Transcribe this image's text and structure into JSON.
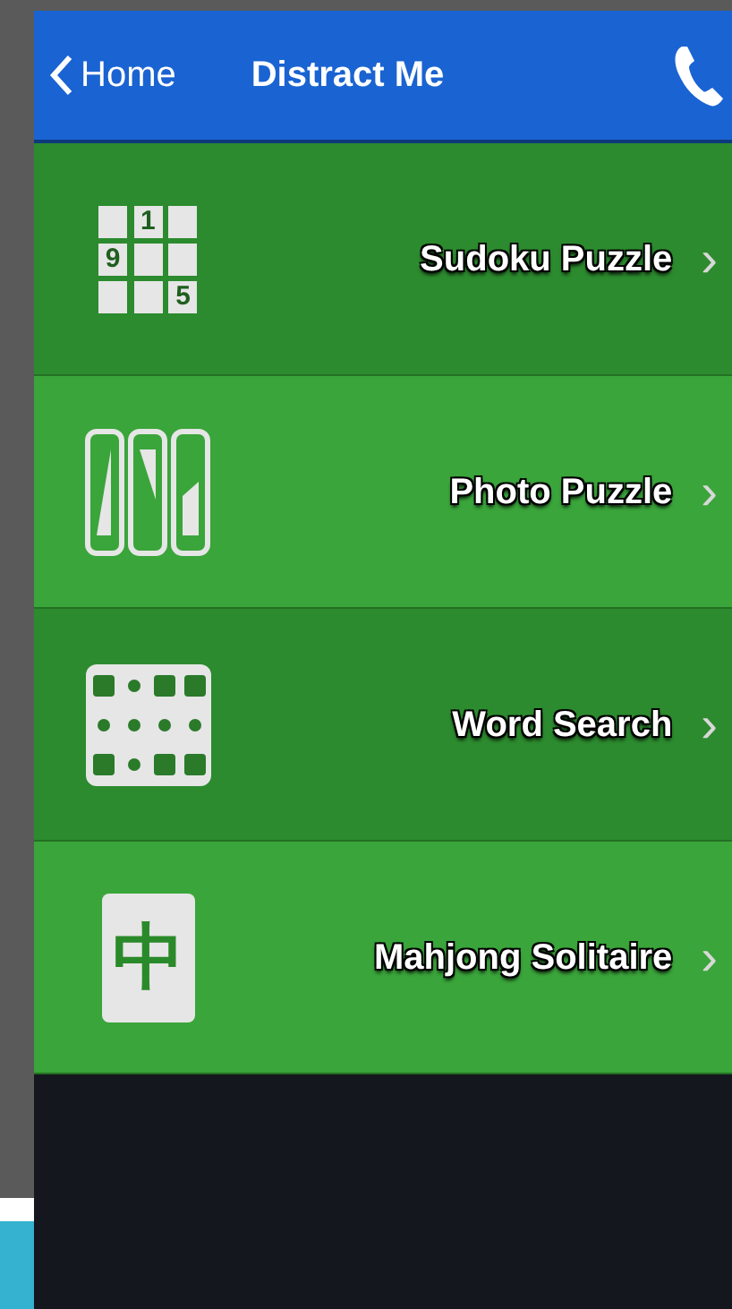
{
  "nav_bar": {
    "back": "Home",
    "title": "Distract Me"
  },
  "items": [
    {
      "kind": "sudoku",
      "label": "Sudoku Puzzle",
      "chevron": "›",
      "cells": [
        {
          "kind": "blank"
        },
        {
          "kind": "digit",
          "digit": "1"
        },
        {
          "kind": "blank"
        },
        {
          "kind": "digit",
          "digit": "9"
        },
        {
          "kind": "blank"
        },
        {
          "kind": "blank"
        },
        {
          "kind": "blank"
        },
        {
          "kind": "blank"
        },
        {
          "kind": "digit",
          "digit": "5"
        }
      ]
    },
    {
      "kind": "photo",
      "label": "Photo Puzzle",
      "chevron": "›"
    },
    {
      "kind": "wordsearch",
      "label": "Word Search",
      "chevron": "›"
    },
    {
      "kind": "mahjong",
      "label": "Mahjong Solitaire",
      "chevron": "›",
      "tile": "中"
    }
  ]
}
